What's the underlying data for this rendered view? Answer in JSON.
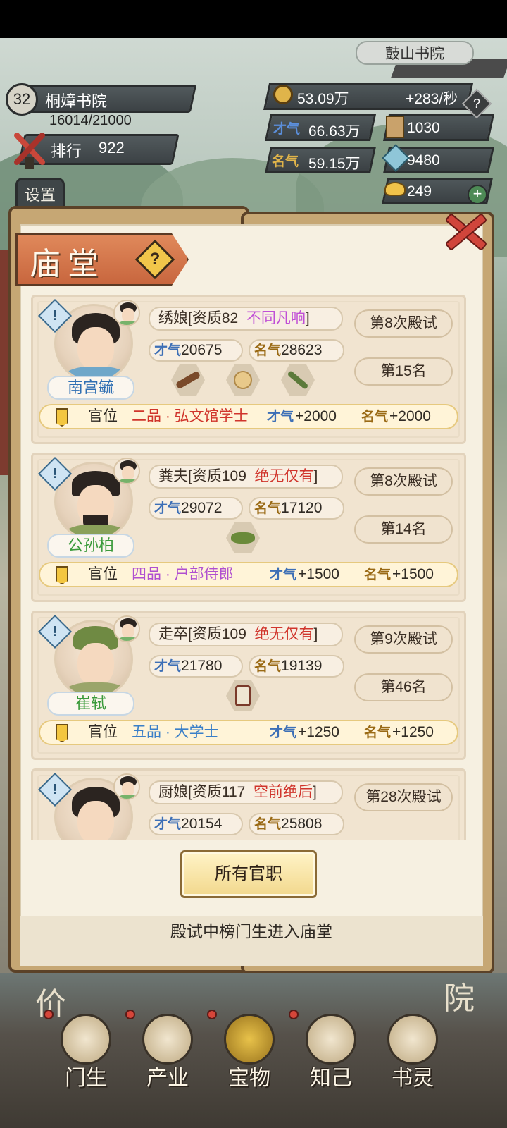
{
  "hud": {
    "level": "32",
    "academy_name": "桐嫜书院",
    "academy_progress": "16014/21000",
    "rank_label": "排行",
    "rank_value": "922",
    "settings_label": "设置",
    "other_academy": "鼓山书院",
    "coins": "53.09万",
    "coin_rate": "+283/秒",
    "talent_label": "才气",
    "talent_total": "66.63万",
    "fame_label": "名气",
    "fame_total": "59.15万",
    "books": "1030",
    "gems": "9480",
    "gold": "249",
    "help_glyph": "?",
    "plus_glyph": "+"
  },
  "modal": {
    "title": "庙堂",
    "help_glyph": "?",
    "alert_glyph": "!",
    "office_label": "官位",
    "all_posts_button": "所有官职",
    "footer_note": "殿试中榜门生进入庙堂"
  },
  "students": [
    {
      "name": "南宫毓",
      "name_color": "#2f6fb3",
      "role": "绣娘",
      "aptitude": "[资质82",
      "grade": "不同凡响",
      "grade_color": "#c04fd6",
      "bracket_close": "]",
      "talent": "20675",
      "fame": "28623",
      "exam": "第8次殿试",
      "place": "第15名",
      "office": "二品 · 弘文馆学士",
      "office_color": "#d0352c",
      "office_talent": "+2000",
      "office_fame": "+2000",
      "items": [
        "wooden-ruler",
        "hairpin",
        "brush"
      ]
    },
    {
      "name": "公孙柏",
      "name_color": "#3a9a3a",
      "role": "粪夫",
      "aptitude": "[资质109",
      "grade": "绝无仅有",
      "grade_color": "#d0352c",
      "bracket_close": "]",
      "talent": "29072",
      "fame": "17120",
      "exam": "第8次殿试",
      "place": "第14名",
      "office": "四品 · 户部侍郎",
      "office_color": "#b04fd0",
      "office_talent": "+1500",
      "office_fame": "+1500",
      "items": [
        "herbs"
      ]
    },
    {
      "name": "崔轼",
      "name_color": "#3a9a3a",
      "role": "走卒",
      "aptitude": "[资质109",
      "grade": "绝无仅有",
      "grade_color": "#d0352c",
      "bracket_close": "]",
      "talent": "21780",
      "fame": "19139",
      "exam": "第9次殿试",
      "place": "第46名",
      "office": "五品 · 大学士",
      "office_color": "#3a7fc8",
      "office_talent": "+1250",
      "office_fame": "+1250",
      "items": [
        "scroll-frame"
      ]
    },
    {
      "name": "",
      "name_color": "#3a9a3a",
      "role": "厨娘",
      "aptitude": "[资质117",
      "grade": "空前绝后",
      "grade_color": "#d0352c",
      "bracket_close": "]",
      "talent": "20154",
      "fame": "25808",
      "exam": "第28次殿试",
      "place": "",
      "office": "",
      "office_color": "#d0352c",
      "office_talent": "",
      "office_fame": "",
      "items": []
    }
  ],
  "bottom_nav": [
    {
      "label": "门生",
      "badge": true
    },
    {
      "label": "产业",
      "badge": true
    },
    {
      "label": "宝物",
      "badge": true
    },
    {
      "label": "知己",
      "badge": true
    },
    {
      "label": "书灵",
      "badge": false
    }
  ],
  "side_signs": {
    "left": "价",
    "right": "院"
  }
}
